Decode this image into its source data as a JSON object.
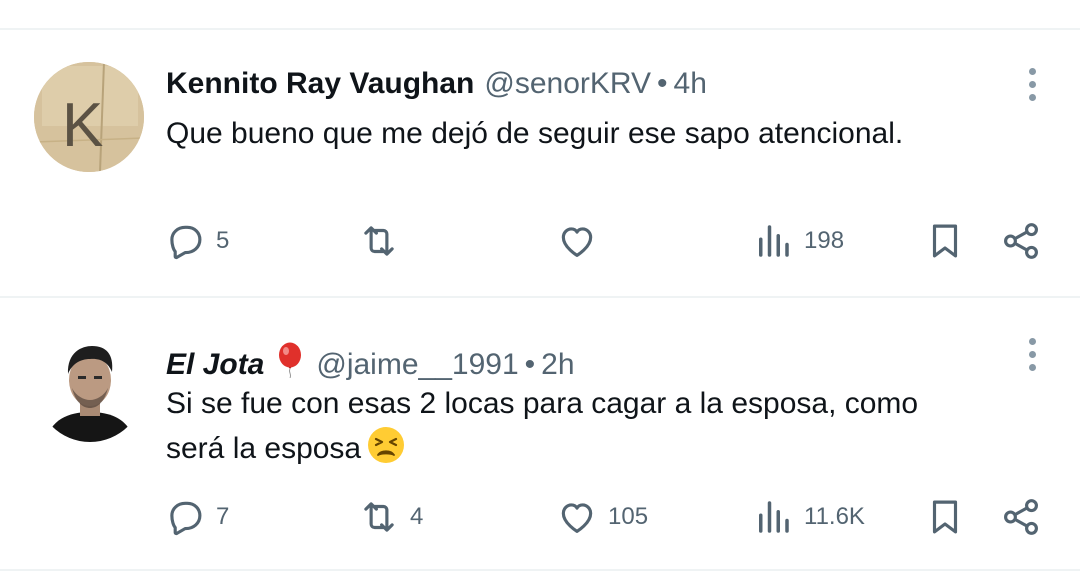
{
  "colors": {
    "text": "#0f1419",
    "muted": "#536471",
    "icon": "#536471",
    "divider": "#eff3f4"
  },
  "tweets": [
    {
      "name": "Kennito Ray Vaughan",
      "handle": "@senorKRV",
      "separator": "•",
      "time": "4h",
      "avatar_letter": "K",
      "text": "Que bueno que me dejó de seguir ese sapo atencional.",
      "stats": {
        "replies": "5",
        "reposts": "",
        "likes": "",
        "views": "198"
      }
    },
    {
      "name": "El Jota",
      "badge_icon": "red-balloon-icon",
      "handle": "@jaime__1991",
      "separator": "•",
      "time": "2h",
      "text_line1": "Si se fue con esas 2 locas para cagar a la esposa, como",
      "text_line2": "será la esposa",
      "emoji_icon": "tired-face-emoji",
      "stats": {
        "replies": "7",
        "reposts": "4",
        "likes": "105",
        "views": "11.6K"
      }
    }
  ]
}
